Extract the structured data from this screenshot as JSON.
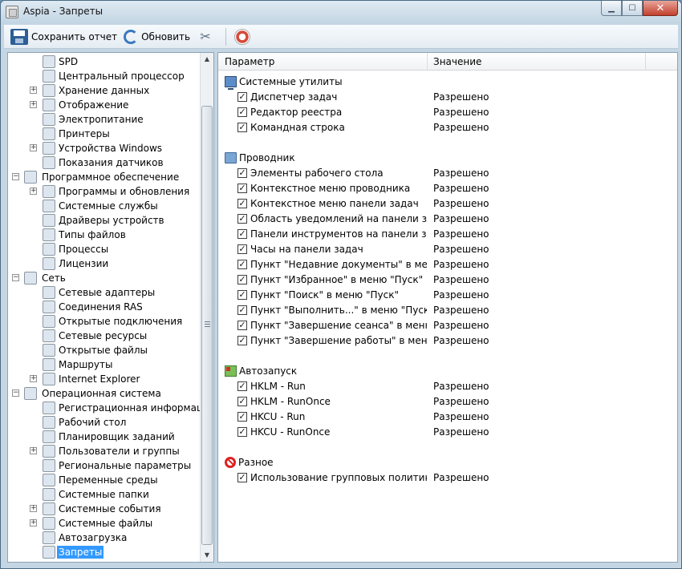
{
  "window": {
    "title": "Aspia - Запреты",
    "minimize": "▁",
    "maximize": "☐",
    "close": "✕"
  },
  "toolbar": {
    "save_label": "Сохранить отчет",
    "refresh_label": "Обновить",
    "tools_glyph": "✂"
  },
  "tree": [
    {
      "label": "SPD",
      "level": 2,
      "expander": "",
      "icon": "chip-icon"
    },
    {
      "label": "Центральный процессор",
      "level": 2,
      "expander": "",
      "icon": "cpu-icon"
    },
    {
      "label": "Хранение данных",
      "level": 2,
      "expander": "+",
      "icon": "disk-icon"
    },
    {
      "label": "Отображение",
      "level": 2,
      "expander": "+",
      "icon": "monitor-icon"
    },
    {
      "label": "Электропитание",
      "level": 2,
      "expander": "",
      "icon": "power-icon"
    },
    {
      "label": "Принтеры",
      "level": 2,
      "expander": "",
      "icon": "printer-icon"
    },
    {
      "label": "Устройства Windows",
      "level": 2,
      "expander": "+",
      "icon": "device-icon"
    },
    {
      "label": "Показания датчиков",
      "level": 2,
      "expander": "",
      "icon": "sensor-icon"
    },
    {
      "label": "Программное обеспечение",
      "level": 1,
      "expander": "−",
      "icon": "software-icon"
    },
    {
      "label": "Программы и обновления",
      "level": 2,
      "expander": "+",
      "icon": "programs-icon"
    },
    {
      "label": "Системные службы",
      "level": 2,
      "expander": "",
      "icon": "services-icon"
    },
    {
      "label": "Драйверы устройств",
      "level": 2,
      "expander": "",
      "icon": "driver-icon"
    },
    {
      "label": "Типы файлов",
      "level": 2,
      "expander": "",
      "icon": "filetype-icon"
    },
    {
      "label": "Процессы",
      "level": 2,
      "expander": "",
      "icon": "process-icon"
    },
    {
      "label": "Лицензии",
      "level": 2,
      "expander": "",
      "icon": "license-icon"
    },
    {
      "label": "Сеть",
      "level": 1,
      "expander": "−",
      "icon": "network-icon"
    },
    {
      "label": "Сетевые адаптеры",
      "level": 2,
      "expander": "",
      "icon": "adapter-icon"
    },
    {
      "label": "Соединения RAS",
      "level": 2,
      "expander": "",
      "icon": "ras-icon"
    },
    {
      "label": "Открытые подключения",
      "level": 2,
      "expander": "",
      "icon": "connection-icon"
    },
    {
      "label": "Сетевые ресурсы",
      "level": 2,
      "expander": "",
      "icon": "share-icon"
    },
    {
      "label": "Открытые файлы",
      "level": 2,
      "expander": "",
      "icon": "openfile-icon"
    },
    {
      "label": "Маршруты",
      "level": 2,
      "expander": "",
      "icon": "route-icon"
    },
    {
      "label": "Internet Explorer",
      "level": 2,
      "expander": "+",
      "icon": "ie-icon"
    },
    {
      "label": "Операционная система",
      "level": 1,
      "expander": "−",
      "icon": "windows-icon"
    },
    {
      "label": "Регистрационная информация",
      "level": 2,
      "expander": "",
      "icon": "registration-icon"
    },
    {
      "label": "Рабочий стол",
      "level": 2,
      "expander": "",
      "icon": "desktop-icon"
    },
    {
      "label": "Планировщик заданий",
      "level": 2,
      "expander": "",
      "icon": "scheduler-icon"
    },
    {
      "label": "Пользователи и группы",
      "level": 2,
      "expander": "+",
      "icon": "users-icon"
    },
    {
      "label": "Региональные параметры",
      "level": 2,
      "expander": "",
      "icon": "regional-icon"
    },
    {
      "label": "Переменные среды",
      "level": 2,
      "expander": "",
      "icon": "envvar-icon"
    },
    {
      "label": "Системные папки",
      "level": 2,
      "expander": "",
      "icon": "sysfolder-icon"
    },
    {
      "label": "Системные события",
      "level": 2,
      "expander": "+",
      "icon": "events-icon"
    },
    {
      "label": "Системные файлы",
      "level": 2,
      "expander": "+",
      "icon": "sysfiles-icon"
    },
    {
      "label": "Автозагрузка",
      "level": 2,
      "expander": "",
      "icon": "autorun-icon"
    },
    {
      "label": "Запреты",
      "level": 2,
      "expander": "",
      "icon": "restrictions-icon",
      "selected": true
    }
  ],
  "table": {
    "col_param": "Параметр",
    "col_value": "Значение",
    "groups": [
      {
        "title": "Системные утилиты",
        "icon": "monitor",
        "items": [
          {
            "name": "Диспетчер задач",
            "value": "Разрешено"
          },
          {
            "name": "Редактор реестра",
            "value": "Разрешено"
          },
          {
            "name": "Командная строка",
            "value": "Разрешено"
          }
        ]
      },
      {
        "title": "Проводник",
        "icon": "folder",
        "items": [
          {
            "name": "Элементы рабочего стола",
            "value": "Разрешено"
          },
          {
            "name": "Контекстное меню проводника",
            "value": "Разрешено"
          },
          {
            "name": "Контекстное меню панели задач",
            "value": "Разрешено"
          },
          {
            "name": "Область уведомлений на панели задач",
            "value": "Разрешено"
          },
          {
            "name": "Панели инструментов на панели задач",
            "value": "Разрешено"
          },
          {
            "name": "Часы на панели задач",
            "value": "Разрешено"
          },
          {
            "name": "Пункт \"Недавние документы\" в меню ...",
            "value": "Разрешено"
          },
          {
            "name": "Пункт \"Избранное\" в меню \"Пуск\"",
            "value": "Разрешено"
          },
          {
            "name": "Пункт \"Поиск\" в меню \"Пуск\"",
            "value": "Разрешено"
          },
          {
            "name": "Пункт \"Выполнить...\" в меню \"Пуск\"",
            "value": "Разрешено"
          },
          {
            "name": "Пункт \"Завершение сеанса\" в меню \"...",
            "value": "Разрешено"
          },
          {
            "name": "Пункт \"Завершение работы\" в меню \"...",
            "value": "Разрешено"
          }
        ]
      },
      {
        "title": "Автозапуск",
        "icon": "grid",
        "items": [
          {
            "name": "HKLM - Run",
            "value": "Разрешено"
          },
          {
            "name": "HKLM - RunOnce",
            "value": "Разрешено"
          },
          {
            "name": "HKCU - Run",
            "value": "Разрешено"
          },
          {
            "name": "HKCU - RunOnce",
            "value": "Разрешено"
          }
        ]
      },
      {
        "title": "Разное",
        "icon": "ban",
        "items": [
          {
            "name": "Использование групповых политик",
            "value": "Разрешено"
          }
        ]
      }
    ]
  }
}
